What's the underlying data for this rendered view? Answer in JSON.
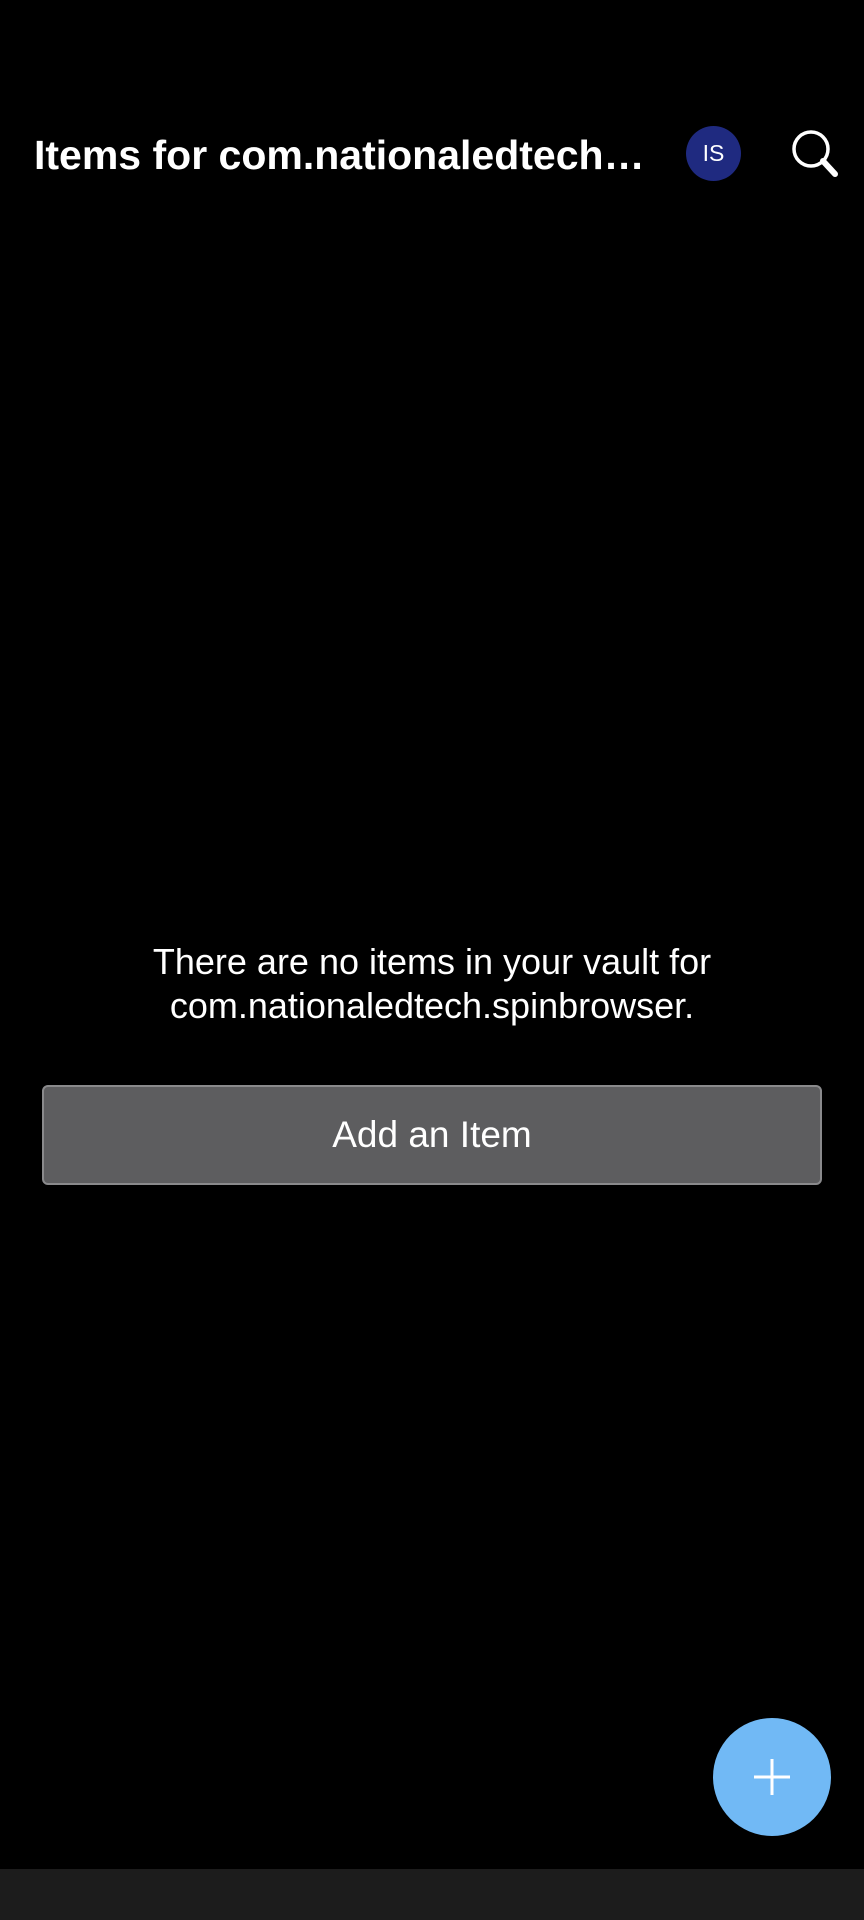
{
  "header": {
    "title": "Items for com.nationaledtech.spinbrowser",
    "avatar_initials": "IS",
    "avatar_color": "#1f2a80",
    "search_icon": "search-icon"
  },
  "main": {
    "empty_line1": "There are no items in your vault for",
    "empty_line2": "com.nationaledtech.spinbrowser.",
    "add_button_label": "Add an Item"
  },
  "fab": {
    "icon": "plus-icon",
    "color": "#71b9f5"
  }
}
